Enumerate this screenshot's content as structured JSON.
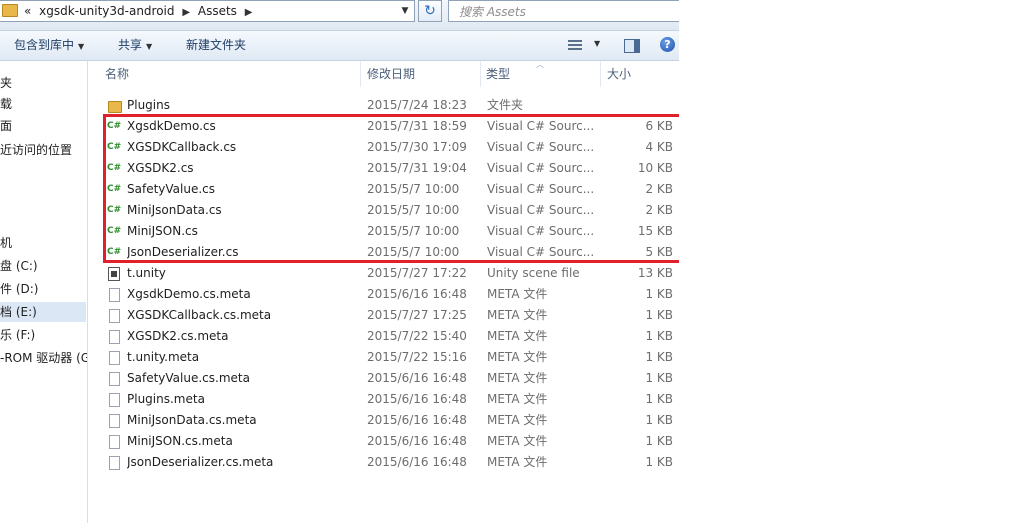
{
  "address_bar": {
    "overflow_chevron": "«",
    "crumbs": [
      "xgsdk-unity3d-android",
      "Assets"
    ],
    "separator_icon": "chevron-right-icon",
    "refresh_icon": "refresh-icon",
    "search_placeholder": "搜索 Assets"
  },
  "toolbar": {
    "include_in_library": "包含到库中",
    "share": "共享",
    "new_folder": "新建文件夹"
  },
  "nav": {
    "items": [
      {
        "label": "夹"
      },
      {
        "label": "载"
      },
      {
        "label": "面"
      },
      {
        "label": "近访问的位置"
      },
      {
        "label": "机"
      },
      {
        "label": "盘 (C:)"
      },
      {
        "label": "件 (D:)"
      },
      {
        "label": "档 (E:)",
        "selected": true
      },
      {
        "label": "乐 (F:)"
      },
      {
        "label": "-ROM 驱动器 (G"
      }
    ]
  },
  "columns": {
    "name": "名称",
    "date": "修改日期",
    "type": "类型",
    "size": "大小"
  },
  "files": [
    {
      "name": "Plugins",
      "date": "2015/7/24 18:23",
      "type": "文件夹",
      "size": "",
      "icon": "folder-icon"
    },
    {
      "name": "XgsdkDemo.cs",
      "date": "2015/7/31 18:59",
      "type": "Visual C# Sourc...",
      "size": "6 KB",
      "icon": "csharp-file-icon"
    },
    {
      "name": "XGSDKCallback.cs",
      "date": "2015/7/30 17:09",
      "type": "Visual C# Sourc...",
      "size": "4 KB",
      "icon": "csharp-file-icon"
    },
    {
      "name": "XGSDK2.cs",
      "date": "2015/7/31 19:04",
      "type": "Visual C# Sourc...",
      "size": "10 KB",
      "icon": "csharp-file-icon"
    },
    {
      "name": "SafetyValue.cs",
      "date": "2015/5/7 10:00",
      "type": "Visual C# Sourc...",
      "size": "2 KB",
      "icon": "csharp-file-icon"
    },
    {
      "name": "MiniJsonData.cs",
      "date": "2015/5/7 10:00",
      "type": "Visual C# Sourc...",
      "size": "2 KB",
      "icon": "csharp-file-icon"
    },
    {
      "name": "MiniJSON.cs",
      "date": "2015/5/7 10:00",
      "type": "Visual C# Sourc...",
      "size": "15 KB",
      "icon": "csharp-file-icon"
    },
    {
      "name": "JsonDeserializer.cs",
      "date": "2015/5/7 10:00",
      "type": "Visual C# Sourc...",
      "size": "5 KB",
      "icon": "csharp-file-icon"
    },
    {
      "name": "t.unity",
      "date": "2015/7/27 17:22",
      "type": "Unity scene file",
      "size": "13 KB",
      "icon": "unity-scene-icon"
    },
    {
      "name": "XgsdkDemo.cs.meta",
      "date": "2015/6/16 16:48",
      "type": "META 文件",
      "size": "1 KB",
      "icon": "meta-file-icon"
    },
    {
      "name": "XGSDKCallback.cs.meta",
      "date": "2015/7/27 17:25",
      "type": "META 文件",
      "size": "1 KB",
      "icon": "meta-file-icon"
    },
    {
      "name": "XGSDK2.cs.meta",
      "date": "2015/7/22 15:40",
      "type": "META 文件",
      "size": "1 KB",
      "icon": "meta-file-icon"
    },
    {
      "name": "t.unity.meta",
      "date": "2015/7/22 15:16",
      "type": "META 文件",
      "size": "1 KB",
      "icon": "meta-file-icon"
    },
    {
      "name": "SafetyValue.cs.meta",
      "date": "2015/6/16 16:48",
      "type": "META 文件",
      "size": "1 KB",
      "icon": "meta-file-icon"
    },
    {
      "name": "Plugins.meta",
      "date": "2015/6/16 16:48",
      "type": "META 文件",
      "size": "1 KB",
      "icon": "meta-file-icon"
    },
    {
      "name": "MiniJsonData.cs.meta",
      "date": "2015/6/16 16:48",
      "type": "META 文件",
      "size": "1 KB",
      "icon": "meta-file-icon"
    },
    {
      "name": "MiniJSON.cs.meta",
      "date": "2015/6/16 16:48",
      "type": "META 文件",
      "size": "1 KB",
      "icon": "meta-file-icon"
    },
    {
      "name": "JsonDeserializer.cs.meta",
      "date": "2015/6/16 16:48",
      "type": "META 文件",
      "size": "1 KB",
      "icon": "meta-file-icon"
    }
  ],
  "highlight": {
    "color": "#e0202a",
    "covers": [
      "XgsdkDemo.cs",
      "XGSDKCallback.cs",
      "XGSDK2.cs",
      "SafetyValue.cs",
      "MiniJsonData.cs",
      "MiniJSON.cs",
      "JsonDeserializer.cs"
    ]
  }
}
